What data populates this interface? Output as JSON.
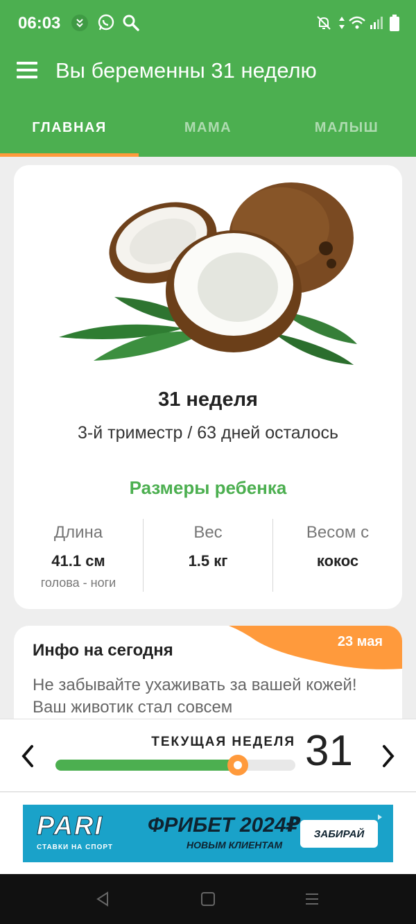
{
  "status_bar": {
    "time": "06:03",
    "left_icons": [
      "notification-app-icon",
      "whatsapp-icon",
      "search-icon"
    ],
    "right_icons": [
      "silent-mode-icon",
      "data-arrows-icon",
      "wifi-icon",
      "cellular-signal-icon",
      "battery-icon"
    ]
  },
  "app_bar": {
    "title": "Вы беременны 31 неделю",
    "menu_icon": "hamburger-menu-icon"
  },
  "tabs": [
    {
      "label": "ГЛАВНАЯ",
      "active": true
    },
    {
      "label": "МАМА",
      "active": false
    },
    {
      "label": "МАЛЫШ",
      "active": false
    }
  ],
  "week_card": {
    "image": "coconut",
    "title": "31 неделя",
    "subtitle": "3-й триместр / 63 дней осталось",
    "sizes_heading": "Размеры ребенка",
    "stats": [
      {
        "label": "Длина",
        "value": "41.1 см",
        "note": "голова - ноги"
      },
      {
        "label": "Вес",
        "value": "1.5 кг",
        "note": ""
      },
      {
        "label": "Весом с",
        "value": "кокос",
        "note": ""
      }
    ]
  },
  "info_card": {
    "title": "Инфо на сегодня",
    "date": "23 мая",
    "text": "Не забывайте ухаживать за вашей кожей! Ваш животик стал совсем"
  },
  "week_selector": {
    "label": "ТЕКУЩАЯ НЕДЕЛЯ",
    "week": "31",
    "progress_fraction": 0.76,
    "prev_icon": "chevron-left-icon",
    "next_icon": "chevron-right-icon"
  },
  "ad": {
    "brand": "PARI",
    "brand_tagline": "СТАВКИ НА СПОРТ",
    "headline": "ФРИБЕТ 2024₽",
    "subline": "НОВЫМ КЛИЕНТАМ",
    "cta": "ЗАБИРАЙ"
  },
  "colors": {
    "primary": "#4caf50",
    "accent": "#ff9a3c",
    "background": "#eeeeee"
  }
}
